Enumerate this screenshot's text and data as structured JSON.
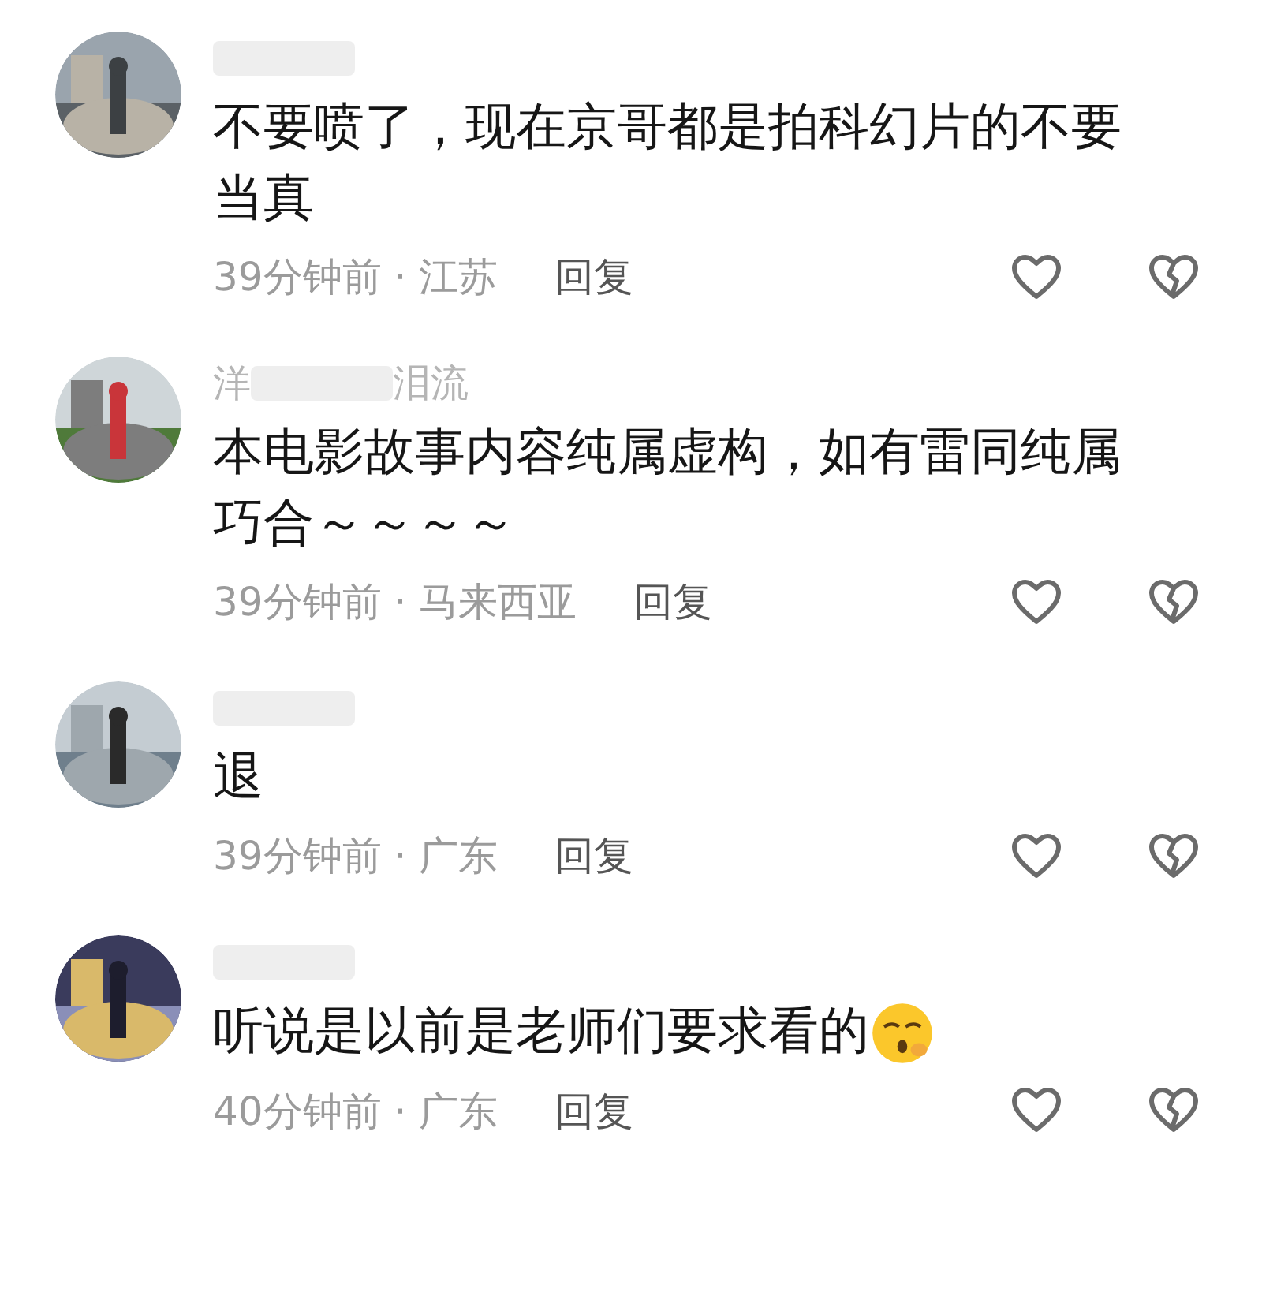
{
  "comments": [
    {
      "text": "不要喷了，现在京哥都是拍科幻片的不要当真",
      "time": "39分钟前",
      "separator": "·",
      "location": "江苏",
      "reply": "回复"
    },
    {
      "name_parts": [
        "洋",
        "泪流"
      ],
      "text": "本电影故事内容纯属虚构，如有雷同纯属巧合～～～～",
      "time": "39分钟前",
      "separator": "·",
      "location": "马来西亚",
      "reply": "回复"
    },
    {
      "text": "退",
      "time": "39分钟前",
      "separator": "·",
      "location": "广东",
      "reply": "回复"
    },
    {
      "text": "听说是以前是老师们要求看的",
      "emoji": {
        "kind": "sleepy-face"
      },
      "time": "40分钟前",
      "separator": "·",
      "location": "广东",
      "reply": "回复"
    }
  ]
}
